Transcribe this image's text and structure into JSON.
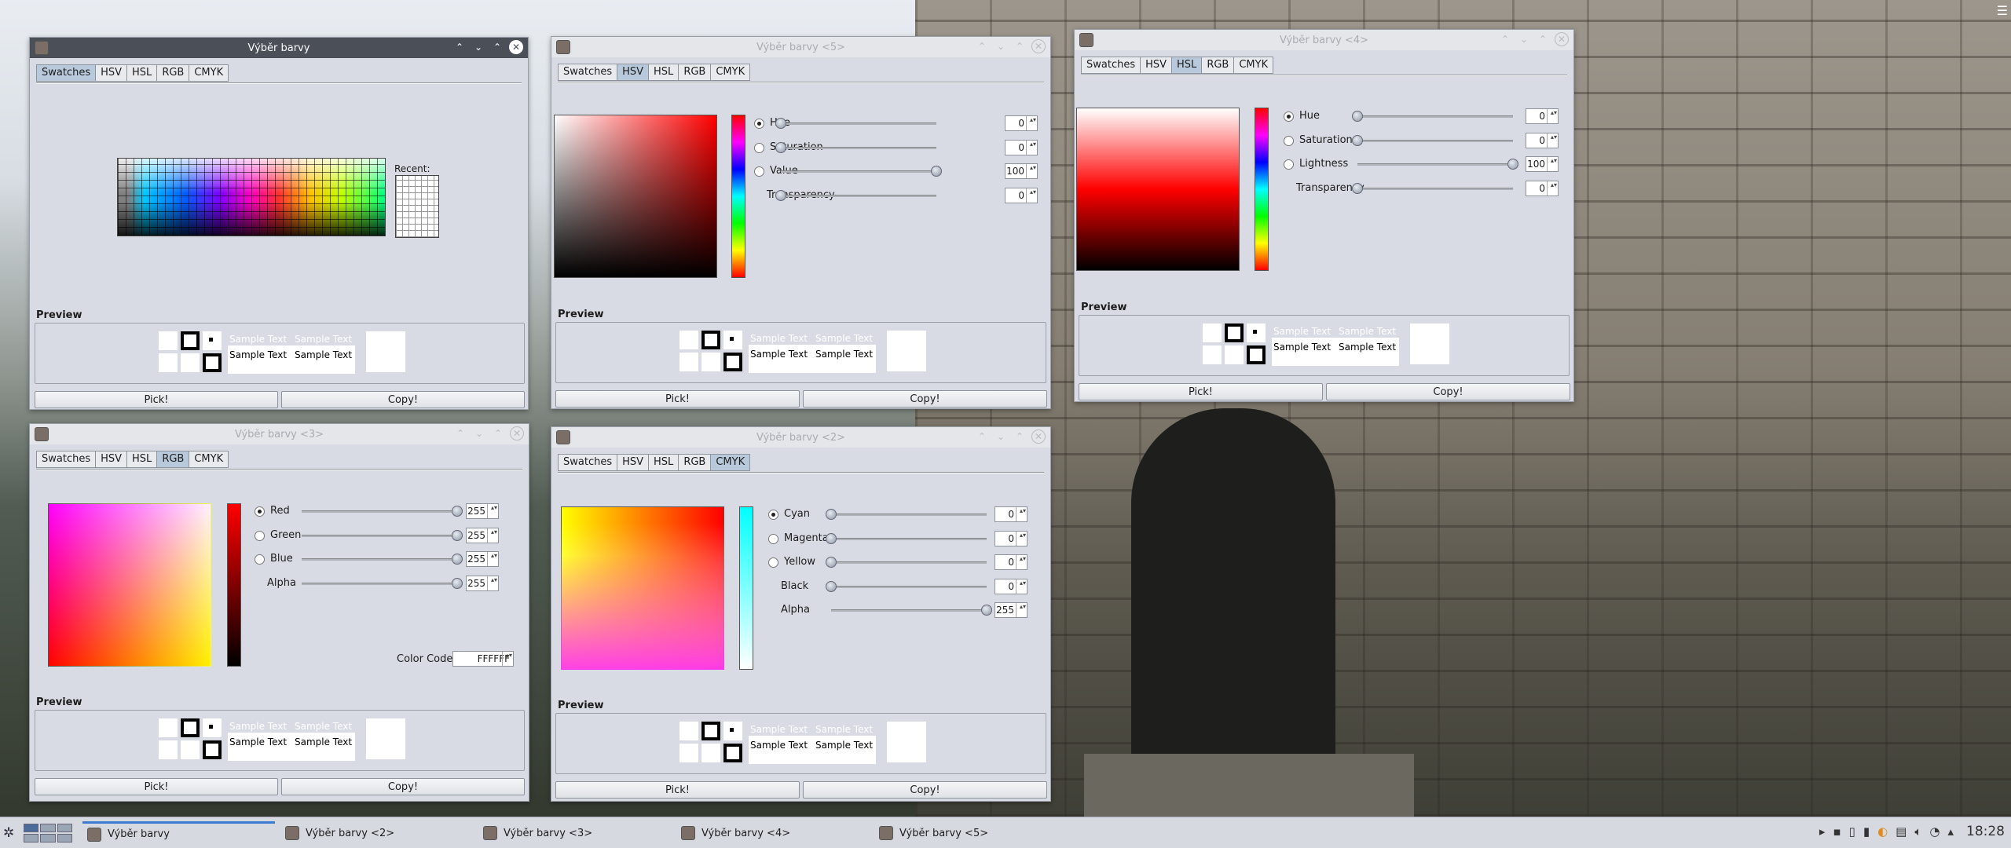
{
  "swatch_window": {
    "title": "Výběr barvy",
    "tabs": [
      "Swatches",
      "HSV",
      "HSL",
      "RGB",
      "CMYK"
    ],
    "selected_tab": "Swatches",
    "recent_label": "Recent:"
  },
  "hsv_window": {
    "title": "Výběr barvy <5>",
    "tabs": [
      "Swatches",
      "HSV",
      "HSL",
      "RGB",
      "CMYK"
    ],
    "selected_tab": "HSV",
    "fields": [
      {
        "label": "Hue",
        "value": "0",
        "radio": true,
        "checked": true,
        "level": 0
      },
      {
        "label": "Saturation",
        "value": "0",
        "radio": true,
        "checked": false,
        "level": 0
      },
      {
        "label": "Value",
        "value": "100",
        "radio": true,
        "checked": false,
        "level": 1
      },
      {
        "label": "Transparency",
        "value": "0",
        "radio": false,
        "level": 0
      }
    ]
  },
  "hsl_window": {
    "title": "Výběr barvy <4>",
    "tabs": [
      "Swatches",
      "HSV",
      "HSL",
      "RGB",
      "CMYK"
    ],
    "selected_tab": "HSL",
    "fields": [
      {
        "label": "Hue",
        "value": "0",
        "radio": true,
        "checked": true,
        "level": 0
      },
      {
        "label": "Saturation",
        "value": "0",
        "radio": true,
        "checked": false,
        "level": 0
      },
      {
        "label": "Lightness",
        "value": "100",
        "radio": true,
        "checked": false,
        "level": 1
      },
      {
        "label": "Transparency",
        "value": "0",
        "radio": false,
        "level": 0
      }
    ]
  },
  "rgb_window": {
    "title": "Výběr barvy <3>",
    "tabs": [
      "Swatches",
      "HSV",
      "HSL",
      "RGB",
      "CMYK"
    ],
    "selected_tab": "RGB",
    "fields": [
      {
        "label": "Red",
        "value": "255",
        "radio": true,
        "checked": true,
        "level": 1
      },
      {
        "label": "Green",
        "value": "255",
        "radio": true,
        "checked": false,
        "level": 1
      },
      {
        "label": "Blue",
        "value": "255",
        "radio": true,
        "checked": false,
        "level": 1
      },
      {
        "label": "Alpha",
        "value": "255",
        "radio": false,
        "level": 1
      }
    ],
    "color_code_label": "Color Code",
    "color_code": "FFFFFF"
  },
  "cmyk_window": {
    "title": "Výběr barvy <2>",
    "tabs": [
      "Swatches",
      "HSV",
      "HSL",
      "RGB",
      "CMYK"
    ],
    "selected_tab": "CMYK",
    "fields": [
      {
        "label": "Cyan",
        "value": "0",
        "radio": true,
        "checked": true,
        "level": 0
      },
      {
        "label": "Magenta",
        "value": "0",
        "radio": true,
        "checked": false,
        "level": 0
      },
      {
        "label": "Yellow",
        "value": "0",
        "radio": true,
        "checked": false,
        "level": 0
      },
      {
        "label": "Black",
        "value": "0",
        "radio": false,
        "level": 0
      },
      {
        "label": "Alpha",
        "value": "255",
        "radio": false,
        "level": 1
      }
    ]
  },
  "common": {
    "preview_label": "Preview",
    "sample_text": "Sample Text",
    "pick_label": "Pick!",
    "copy_label": "Copy!"
  },
  "taskbar": {
    "tasks": [
      "Výběr barvy",
      "Výběr barvy <2>",
      "Výběr barvy <3>",
      "Výběr barvy <4>",
      "Výběr barvy <5>"
    ],
    "active_task": 0,
    "clock": "18:28"
  }
}
